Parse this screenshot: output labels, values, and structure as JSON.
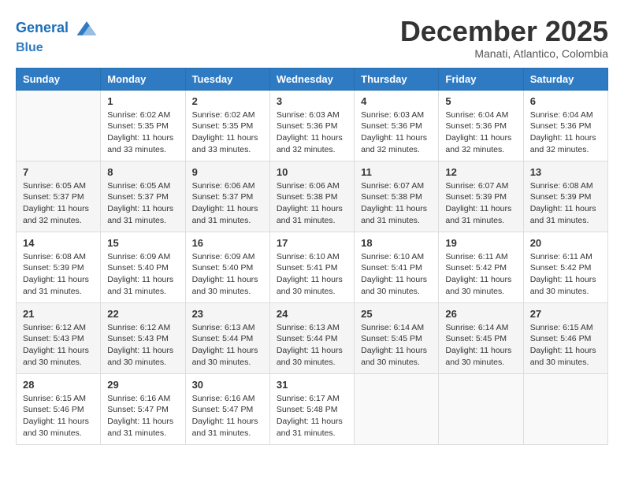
{
  "header": {
    "logo_line1": "General",
    "logo_line2": "Blue",
    "month_title": "December 2025",
    "subtitle": "Manati, Atlantico, Colombia"
  },
  "weekdays": [
    "Sunday",
    "Monday",
    "Tuesday",
    "Wednesday",
    "Thursday",
    "Friday",
    "Saturday"
  ],
  "weeks": [
    [
      {
        "day": "",
        "sunrise": "",
        "sunset": "",
        "daylight": ""
      },
      {
        "day": "1",
        "sunrise": "Sunrise: 6:02 AM",
        "sunset": "Sunset: 5:35 PM",
        "daylight": "Daylight: 11 hours and 33 minutes."
      },
      {
        "day": "2",
        "sunrise": "Sunrise: 6:02 AM",
        "sunset": "Sunset: 5:35 PM",
        "daylight": "Daylight: 11 hours and 33 minutes."
      },
      {
        "day": "3",
        "sunrise": "Sunrise: 6:03 AM",
        "sunset": "Sunset: 5:36 PM",
        "daylight": "Daylight: 11 hours and 32 minutes."
      },
      {
        "day": "4",
        "sunrise": "Sunrise: 6:03 AM",
        "sunset": "Sunset: 5:36 PM",
        "daylight": "Daylight: 11 hours and 32 minutes."
      },
      {
        "day": "5",
        "sunrise": "Sunrise: 6:04 AM",
        "sunset": "Sunset: 5:36 PM",
        "daylight": "Daylight: 11 hours and 32 minutes."
      },
      {
        "day": "6",
        "sunrise": "Sunrise: 6:04 AM",
        "sunset": "Sunset: 5:36 PM",
        "daylight": "Daylight: 11 hours and 32 minutes."
      }
    ],
    [
      {
        "day": "7",
        "sunrise": "Sunrise: 6:05 AM",
        "sunset": "Sunset: 5:37 PM",
        "daylight": "Daylight: 11 hours and 32 minutes."
      },
      {
        "day": "8",
        "sunrise": "Sunrise: 6:05 AM",
        "sunset": "Sunset: 5:37 PM",
        "daylight": "Daylight: 11 hours and 31 minutes."
      },
      {
        "day": "9",
        "sunrise": "Sunrise: 6:06 AM",
        "sunset": "Sunset: 5:37 PM",
        "daylight": "Daylight: 11 hours and 31 minutes."
      },
      {
        "day": "10",
        "sunrise": "Sunrise: 6:06 AM",
        "sunset": "Sunset: 5:38 PM",
        "daylight": "Daylight: 11 hours and 31 minutes."
      },
      {
        "day": "11",
        "sunrise": "Sunrise: 6:07 AM",
        "sunset": "Sunset: 5:38 PM",
        "daylight": "Daylight: 11 hours and 31 minutes."
      },
      {
        "day": "12",
        "sunrise": "Sunrise: 6:07 AM",
        "sunset": "Sunset: 5:39 PM",
        "daylight": "Daylight: 11 hours and 31 minutes."
      },
      {
        "day": "13",
        "sunrise": "Sunrise: 6:08 AM",
        "sunset": "Sunset: 5:39 PM",
        "daylight": "Daylight: 11 hours and 31 minutes."
      }
    ],
    [
      {
        "day": "14",
        "sunrise": "Sunrise: 6:08 AM",
        "sunset": "Sunset: 5:39 PM",
        "daylight": "Daylight: 11 hours and 31 minutes."
      },
      {
        "day": "15",
        "sunrise": "Sunrise: 6:09 AM",
        "sunset": "Sunset: 5:40 PM",
        "daylight": "Daylight: 11 hours and 31 minutes."
      },
      {
        "day": "16",
        "sunrise": "Sunrise: 6:09 AM",
        "sunset": "Sunset: 5:40 PM",
        "daylight": "Daylight: 11 hours and 30 minutes."
      },
      {
        "day": "17",
        "sunrise": "Sunrise: 6:10 AM",
        "sunset": "Sunset: 5:41 PM",
        "daylight": "Daylight: 11 hours and 30 minutes."
      },
      {
        "day": "18",
        "sunrise": "Sunrise: 6:10 AM",
        "sunset": "Sunset: 5:41 PM",
        "daylight": "Daylight: 11 hours and 30 minutes."
      },
      {
        "day": "19",
        "sunrise": "Sunrise: 6:11 AM",
        "sunset": "Sunset: 5:42 PM",
        "daylight": "Daylight: 11 hours and 30 minutes."
      },
      {
        "day": "20",
        "sunrise": "Sunrise: 6:11 AM",
        "sunset": "Sunset: 5:42 PM",
        "daylight": "Daylight: 11 hours and 30 minutes."
      }
    ],
    [
      {
        "day": "21",
        "sunrise": "Sunrise: 6:12 AM",
        "sunset": "Sunset: 5:43 PM",
        "daylight": "Daylight: 11 hours and 30 minutes."
      },
      {
        "day": "22",
        "sunrise": "Sunrise: 6:12 AM",
        "sunset": "Sunset: 5:43 PM",
        "daylight": "Daylight: 11 hours and 30 minutes."
      },
      {
        "day": "23",
        "sunrise": "Sunrise: 6:13 AM",
        "sunset": "Sunset: 5:44 PM",
        "daylight": "Daylight: 11 hours and 30 minutes."
      },
      {
        "day": "24",
        "sunrise": "Sunrise: 6:13 AM",
        "sunset": "Sunset: 5:44 PM",
        "daylight": "Daylight: 11 hours and 30 minutes."
      },
      {
        "day": "25",
        "sunrise": "Sunrise: 6:14 AM",
        "sunset": "Sunset: 5:45 PM",
        "daylight": "Daylight: 11 hours and 30 minutes."
      },
      {
        "day": "26",
        "sunrise": "Sunrise: 6:14 AM",
        "sunset": "Sunset: 5:45 PM",
        "daylight": "Daylight: 11 hours and 30 minutes."
      },
      {
        "day": "27",
        "sunrise": "Sunrise: 6:15 AM",
        "sunset": "Sunset: 5:46 PM",
        "daylight": "Daylight: 11 hours and 30 minutes."
      }
    ],
    [
      {
        "day": "28",
        "sunrise": "Sunrise: 6:15 AM",
        "sunset": "Sunset: 5:46 PM",
        "daylight": "Daylight: 11 hours and 30 minutes."
      },
      {
        "day": "29",
        "sunrise": "Sunrise: 6:16 AM",
        "sunset": "Sunset: 5:47 PM",
        "daylight": "Daylight: 11 hours and 31 minutes."
      },
      {
        "day": "30",
        "sunrise": "Sunrise: 6:16 AM",
        "sunset": "Sunset: 5:47 PM",
        "daylight": "Daylight: 11 hours and 31 minutes."
      },
      {
        "day": "31",
        "sunrise": "Sunrise: 6:17 AM",
        "sunset": "Sunset: 5:48 PM",
        "daylight": "Daylight: 11 hours and 31 minutes."
      },
      {
        "day": "",
        "sunrise": "",
        "sunset": "",
        "daylight": ""
      },
      {
        "day": "",
        "sunrise": "",
        "sunset": "",
        "daylight": ""
      },
      {
        "day": "",
        "sunrise": "",
        "sunset": "",
        "daylight": ""
      }
    ]
  ]
}
